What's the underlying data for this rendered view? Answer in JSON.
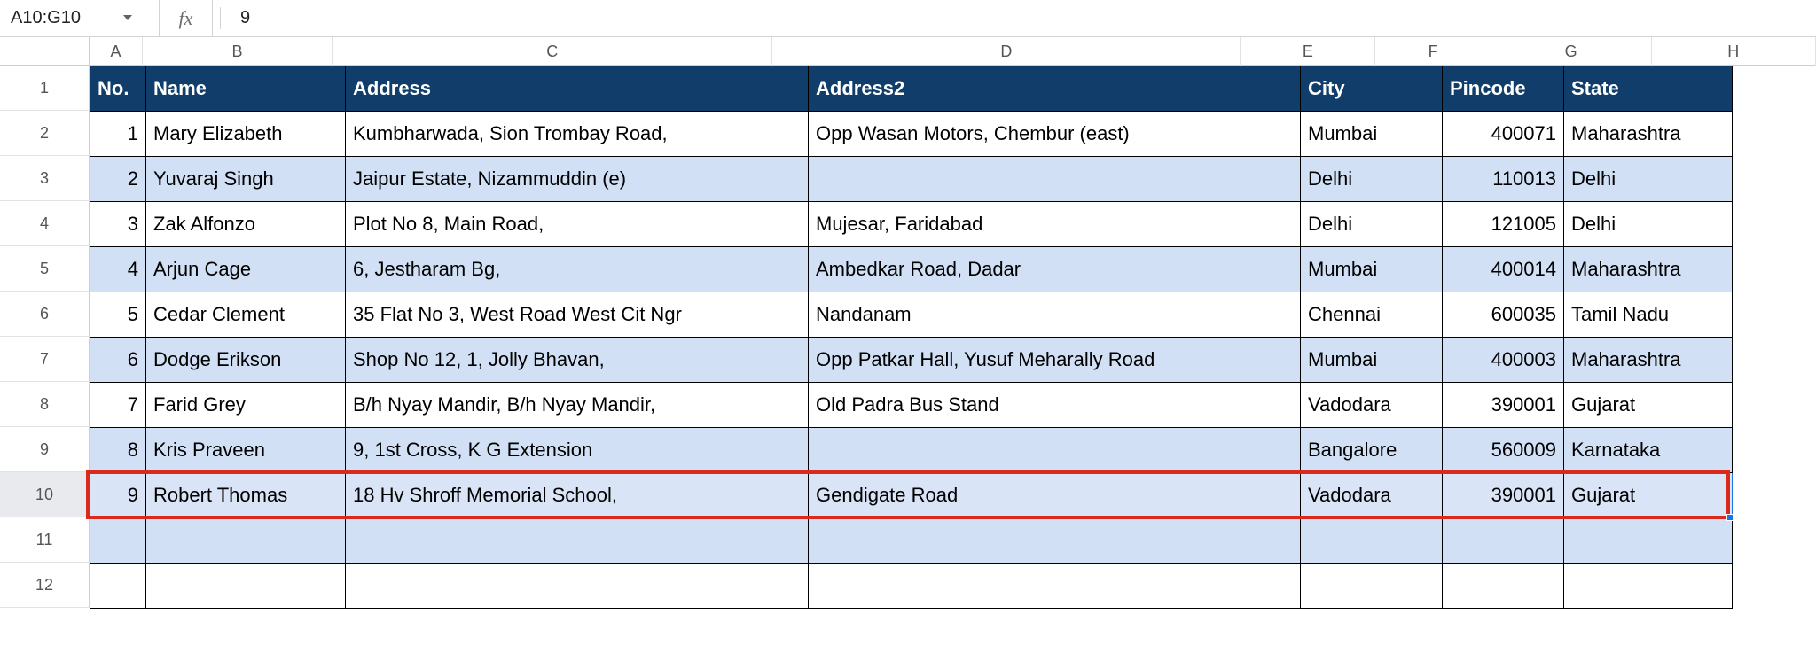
{
  "name_box": "A10:G10",
  "formula_value": "9",
  "fx_label": "fx",
  "col_labels": {
    "A": "A",
    "B": "B",
    "C": "C",
    "D": "D",
    "E": "E",
    "F": "F",
    "G": "G",
    "H": "H"
  },
  "row_labels": {
    "r1": "1",
    "r2": "2",
    "r3": "3",
    "r4": "4",
    "r5": "5",
    "r6": "6",
    "r7": "7",
    "r8": "8",
    "r9": "9",
    "r10": "10",
    "r11": "11",
    "r12": "12"
  },
  "headers": {
    "no": "No.",
    "name": "Name",
    "address": "Address",
    "address2": "Address2",
    "city": "City",
    "pincode": "Pincode",
    "state": "State"
  },
  "rows": [
    {
      "no": "1",
      "name": "Mary Elizabeth",
      "address": "Kumbharwada, Sion Trombay Road,",
      "address2": "Opp Wasan Motors, Chembur (east)",
      "city": "Mumbai",
      "pincode": "400071",
      "state": "Maharashtra"
    },
    {
      "no": "2",
      "name": "Yuvaraj Singh",
      "address": "Jaipur Estate, Nizammuddin (e)",
      "address2": "",
      "city": "Delhi",
      "pincode": "110013",
      "state": "Delhi"
    },
    {
      "no": "3",
      "name": "Zak Alfonzo",
      "address": "Plot No 8, Main Road,",
      "address2": "Mujesar, Faridabad",
      "city": "Delhi",
      "pincode": "121005",
      "state": "Delhi"
    },
    {
      "no": "4",
      "name": "Arjun Cage",
      "address": "6, Jestharam Bg,",
      "address2": "Ambedkar Road, Dadar",
      "city": "Mumbai",
      "pincode": "400014",
      "state": "Maharashtra"
    },
    {
      "no": "5",
      "name": "Cedar Clement",
      "address": "35 Flat No 3, West Road West Cit Ngr",
      "address2": "Nandanam",
      "city": "Chennai",
      "pincode": "600035",
      "state": "Tamil Nadu"
    },
    {
      "no": "6",
      "name": "Dodge Erikson",
      "address": "Shop No 12, 1, Jolly Bhavan,",
      "address2": "Opp Patkar Hall, Yusuf Meharally Road",
      "city": "Mumbai",
      "pincode": "400003",
      "state": "Maharashtra"
    },
    {
      "no": "7",
      "name": "Farid Grey",
      "address": "B/h Nyay Mandir, B/h Nyay Mandir,",
      "address2": "Old Padra Bus Stand",
      "city": "Vadodara",
      "pincode": "390001",
      "state": "Gujarat"
    },
    {
      "no": "8",
      "name": "Kris Praveen",
      "address": "9, 1st Cross, K G Extension",
      "address2": "",
      "city": "Bangalore",
      "pincode": "560009",
      "state": "Karnataka"
    },
    {
      "no": "9",
      "name": "Robert Thomas",
      "address": "18 Hv Shroff Memorial School,",
      "address2": "Gendigate Road",
      "city": "Vadodara",
      "pincode": "390001",
      "state": "Gujarat"
    }
  ],
  "selected_row_index": 8,
  "colors": {
    "header_bg": "#103d6a",
    "band_even_bg": "#d1e0f4",
    "selection_blue": "#1a73e8",
    "red_highlight": "#d92a1c"
  }
}
